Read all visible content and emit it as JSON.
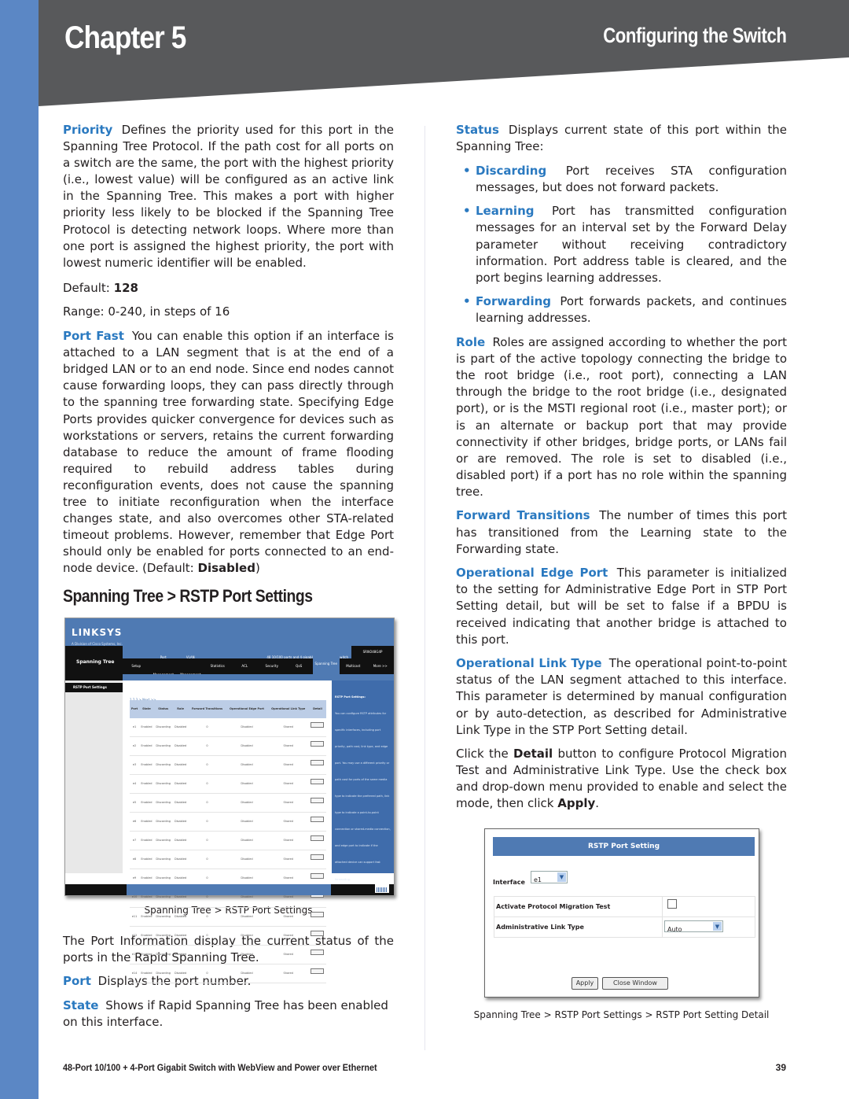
{
  "header": {
    "chapter": "Chapter 5",
    "section": "Configuring the Switch"
  },
  "colors": {
    "accent_blue": "#2a79c0",
    "strip_blue": "#5b87c5",
    "header_gray": "#58595b"
  },
  "left": {
    "priority": {
      "term": "Priority",
      "text": "Defines the priority used for this port in the Spanning Tree Protocol. If the path cost for all ports on a switch are the same, the port with the highest priority (i.e., lowest value) will be configured as an active link in the Spanning Tree. This makes a port with higher priority less likely to be blocked if the Spanning Tree Protocol is detecting network loops. Where more than one port is assigned the highest priority, the port with lowest numeric identifier will be enabled."
    },
    "default_label": "Default:",
    "default_value": "128",
    "range": "Range: 0-240, in steps of 16",
    "port_fast": {
      "term": "Port Fast",
      "text": "You can enable this option if an interface is attached to a LAN segment that is at the end of a bridged LAN or to an end node. Since end nodes cannot cause forwarding loops, they can pass directly through to the spanning tree forwarding state. Specifying Edge Ports provides quicker convergence for devices such as workstations or servers, retains the current forwarding database to reduce the amount of frame flooding required to rebuild address tables during reconfiguration events, does not cause the spanning tree to initiate reconfiguration when the interface changes state, and also overcomes other STA-related timeout problems. However, remember that Edge Port should only be enabled for ports connected to an end-node device. (Default: ",
      "default_value": "Disabled",
      "close": ")"
    },
    "subheading": "Spanning Tree > RSTP Port Settings",
    "screenshot1": {
      "logo": "LINKSYS",
      "logo_sub": "A Division of Cisco Systems, Inc.",
      "left_title": "Spanning Tree",
      "info_text": "48 10/100 ports and 4 gigabit ports with PoE switch",
      "model": "SRW248G4P",
      "nav": [
        "Setup",
        "Port Management",
        "VLAN Management",
        "Statistics",
        "ACL",
        "Security",
        "QoS",
        "Spanning Tree",
        "Multicast",
        "More >>"
      ],
      "left_item": "RSTP Port Settings",
      "pager": "1 2 3 > Next >>",
      "columns": [
        "Port",
        "State",
        "Status",
        "Role",
        "Forward Transitions",
        "Operational Edge Port",
        "Operational Link Type",
        "Detail"
      ],
      "rows": [
        [
          "e1",
          "Enabled",
          "Discarding",
          "Disabled",
          "0",
          "Disabled",
          "Shared",
          "Detail"
        ],
        [
          "e2",
          "Enabled",
          "Discarding",
          "Disabled",
          "0",
          "Disabled",
          "Shared",
          "Detail"
        ],
        [
          "e3",
          "Enabled",
          "Discarding",
          "Disabled",
          "0",
          "Disabled",
          "Shared",
          "Detail"
        ],
        [
          "e4",
          "Enabled",
          "Discarding",
          "Disabled",
          "0",
          "Disabled",
          "Shared",
          "Detail"
        ],
        [
          "e5",
          "Enabled",
          "Discarding",
          "Disabled",
          "0",
          "Disabled",
          "Shared",
          "Detail"
        ],
        [
          "e6",
          "Enabled",
          "Discarding",
          "Disabled",
          "0",
          "Disabled",
          "Shared",
          "Detail"
        ],
        [
          "e7",
          "Enabled",
          "Discarding",
          "Disabled",
          "0",
          "Disabled",
          "Shared",
          "Detail"
        ],
        [
          "e8",
          "Enabled",
          "Discarding",
          "Disabled",
          "0",
          "Disabled",
          "Shared",
          "Detail"
        ],
        [
          "e9",
          "Enabled",
          "Discarding",
          "Disabled",
          "0",
          "Disabled",
          "Shared",
          "Detail"
        ],
        [
          "e10",
          "Enabled",
          "Discarding",
          "Disabled",
          "0",
          "Disabled",
          "Shared",
          "Detail"
        ],
        [
          "e11",
          "Enabled",
          "Discarding",
          "Disabled",
          "0",
          "Disabled",
          "Shared",
          "Detail"
        ],
        [
          "e12",
          "Enabled",
          "Discarding",
          "Disabled",
          "0",
          "Disabled",
          "Shared",
          "Detail"
        ],
        [
          "e13",
          "Enabled",
          "Discarding",
          "Disabled",
          "0",
          "Disabled",
          "Shared",
          "Detail"
        ],
        [
          "e14",
          "Enabled",
          "Discarding",
          "Disabled",
          "0",
          "Disabled",
          "Shared",
          "Detail"
        ]
      ],
      "help_title": "RSTP Port Settings:",
      "help_text": "You can configure RSTP attributes for specific interfaces, including port priority, path cost, link type, and edge port. You may use a different priority or path cost for ports of the same media type to indicate the preferred path, link type to indicate a point-to-point connection or shared-media connection, and edge port to indicate if the attached device can support fast forwarding."
    },
    "caption1": "Spanning Tree > RSTP Port Settings",
    "port_info": "The Port Information display the current status of the ports in the Rapid Spanning Tree.",
    "port": {
      "term": "Port",
      "text": "Displays the port number."
    },
    "state": {
      "term": "State",
      "text": "Shows if Rapid Spanning Tree has been enabled on this interface."
    }
  },
  "right": {
    "status": {
      "term": "Status",
      "text": "Displays current state of this port within the Spanning Tree:"
    },
    "bullets": [
      {
        "term": "Discarding",
        "text": "Port receives STA configuration messages, but does not forward packets."
      },
      {
        "term": "Learning",
        "text": "Port has transmitted configuration messages for an interval set by the Forward Delay parameter without receiving contradictory information. Port address table is cleared, and the port begins learning addresses."
      },
      {
        "term": "Forwarding",
        "text": "Port forwards packets, and continues learning addresses."
      }
    ],
    "role": {
      "term": "Role",
      "text": "Roles are assigned according to whether the port is part of the active topology connecting the bridge to the root bridge (i.e., root port), connecting a LAN through the bridge to the root bridge (i.e., designated port), or is the MSTI regional root (i.e., master port); or is an alternate or backup port that may provide connectivity if other bridges, bridge ports, or LANs fail or are removed. The role is set to disabled (i.e., disabled port) if a port has no role within the spanning tree."
    },
    "forward_transitions": {
      "term": "Forward Transitions",
      "text": "The number of times this port has transitioned from the Learning state to the Forwarding state."
    },
    "operational_edge_port": {
      "term": "Operational Edge Port",
      "text": "This parameter is initialized to the setting for Administrative Edge Port in STP Port Setting detail, but will be set to false if a BPDU is received indicating that another bridge is attached to this port."
    },
    "operational_link_type": {
      "term": "Operational Link Type",
      "text": "The operational point-to-point status of the LAN segment attached to this interface. This parameter is determined by manual configuration or by auto-detection, as described for Administrative Link Type in the STP Port Setting detail."
    },
    "click_detail": {
      "pre": "Click the ",
      "detail": "Detail",
      "mid": " button to configure Protocol Migration Test and Administrative Link Type. Use the check box and drop-down menu provided to enable and select the mode, then click ",
      "apply": "Apply",
      "post": "."
    },
    "screenshot2": {
      "title": "RSTP Port Setting",
      "interface_label": "Interface",
      "interface_value": "e1",
      "migration_label": "Activate Protocol Migration Test",
      "migration_checked": false,
      "link_type_label": "Administrative Link Type",
      "link_type_value": "Auto",
      "apply": "Apply",
      "close": "Close Window"
    },
    "caption2": "Spanning Tree > RSTP Port Settings > RSTP Port Setting Detail"
  },
  "footer": {
    "product": "48-Port 10/100 + 4-Port Gigabit Switch with WebView and Power over Ethernet",
    "page": "39"
  }
}
